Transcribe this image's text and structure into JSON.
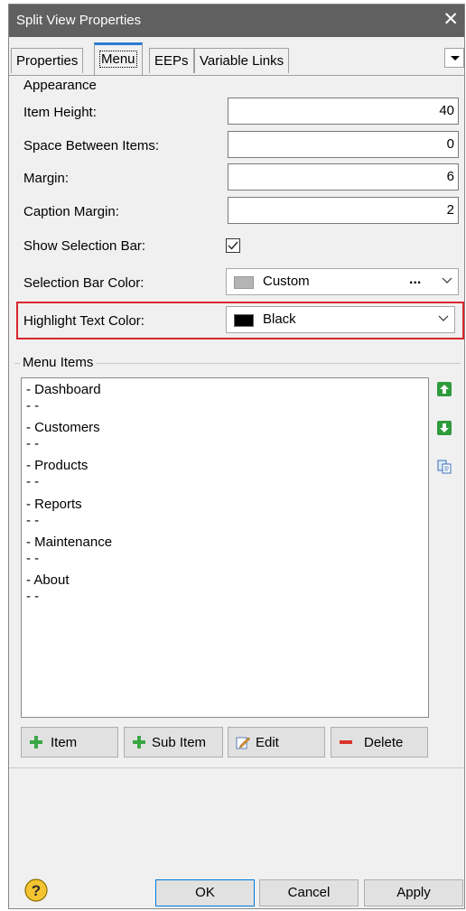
{
  "window": {
    "title": "Split View Properties",
    "close_glyph": "✕"
  },
  "tabs": [
    {
      "label": "Properties",
      "active": false
    },
    {
      "label": "Menu",
      "active": true
    },
    {
      "label": "EEPs",
      "active": false
    },
    {
      "label": "Variable Links",
      "active": false
    }
  ],
  "appearance": {
    "legend": "Appearance",
    "item_height": {
      "label": "Item Height:",
      "value": "40"
    },
    "space_between": {
      "label": "Space Between Items:",
      "value": "0"
    },
    "margin": {
      "label": "Margin:",
      "value": "6"
    },
    "caption_margin": {
      "label": "Caption Margin:",
      "value": "2"
    },
    "show_selection_bar": {
      "label": "Show Selection Bar:",
      "checked": true
    },
    "selection_bar_color": {
      "label": "Selection Bar Color:",
      "value": "Custom",
      "swatch": "#b4b4b4",
      "more": "..."
    },
    "highlight_text_color": {
      "label": "Highlight Text Color:",
      "value": "Black",
      "swatch": "#000000"
    }
  },
  "menu_items": {
    "legend": "Menu Items",
    "items": [
      "- Dashboard",
      "- -",
      "- Customers",
      "- -",
      "- Products",
      "- -",
      "- Reports",
      "- -",
      "- Maintenance",
      "- -",
      "- About",
      "- -"
    ]
  },
  "buttons": {
    "item": "Item",
    "sub_item": "Sub Item",
    "edit": "Edit",
    "delete": "Delete",
    "ok": "OK",
    "cancel": "Cancel",
    "apply": "Apply"
  },
  "colors": {
    "accent": "#2a7bd2",
    "highlight_border": "#d9262c",
    "titlebar": "#606060"
  }
}
